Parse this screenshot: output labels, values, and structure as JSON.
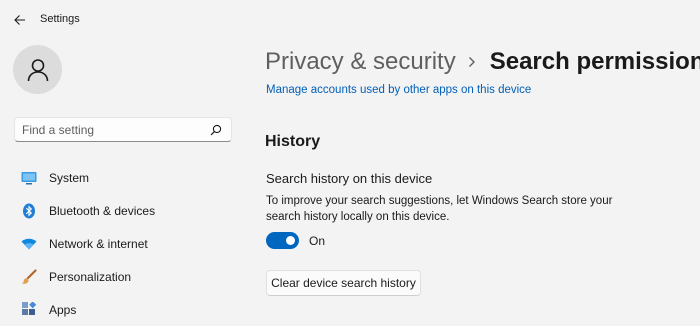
{
  "window": {
    "title": "Settings",
    "back_icon": "back-arrow-icon"
  },
  "sidebar": {
    "avatar_icon": "user-icon",
    "search": {
      "placeholder": "Find a setting",
      "value": "",
      "icon": "search-icon"
    },
    "items": [
      {
        "label": "System",
        "icon": "monitor-icon",
        "color": "#0078d4"
      },
      {
        "label": "Bluetooth & devices",
        "icon": "bluetooth-icon",
        "color": "#0078d4"
      },
      {
        "label": "Network & internet",
        "icon": "wifi-icon",
        "color": "#0a84d8"
      },
      {
        "label": "Personalization",
        "icon": "paintbrush-icon",
        "color": "#c47a3a"
      },
      {
        "label": "Apps",
        "icon": "apps-icon",
        "color": "#4a6fa5"
      }
    ]
  },
  "main": {
    "breadcrumb": {
      "parent": "Privacy & security",
      "separator_icon": "chevron-right-icon",
      "current": "Search permissions"
    },
    "manage_link": "Manage accounts used by other apps on this device",
    "history": {
      "title": "History",
      "setting_title": "Search history on this device",
      "description": "To improve your search suggestions, let Windows Search store your search history locally on this device.",
      "toggle_state": "On",
      "toggle_on": true,
      "clear_button": "Clear device search history"
    }
  },
  "colors": {
    "accent": "#0067c0",
    "link": "#005fb8",
    "background": "#f3f3f3"
  }
}
